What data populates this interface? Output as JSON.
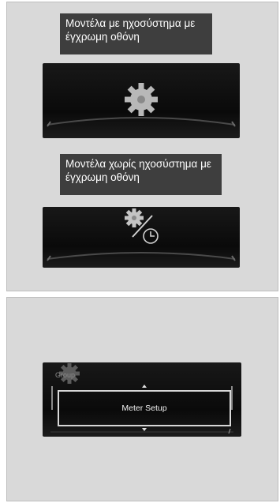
{
  "top_panel": {
    "label_1": "Μοντέλα με ηχοσύστημα με έγχρωμη οθόνη",
    "label_2": "Μοντέλα χωρίς ηχοσύστημα με έγχρωμη οθόνη",
    "icon_1": "gear-icon",
    "icon_2": "gear-clock-icon"
  },
  "bottom_panel": {
    "group_label": "Group",
    "setting_label": "Meter Setup",
    "icon": "gear-icon"
  }
}
